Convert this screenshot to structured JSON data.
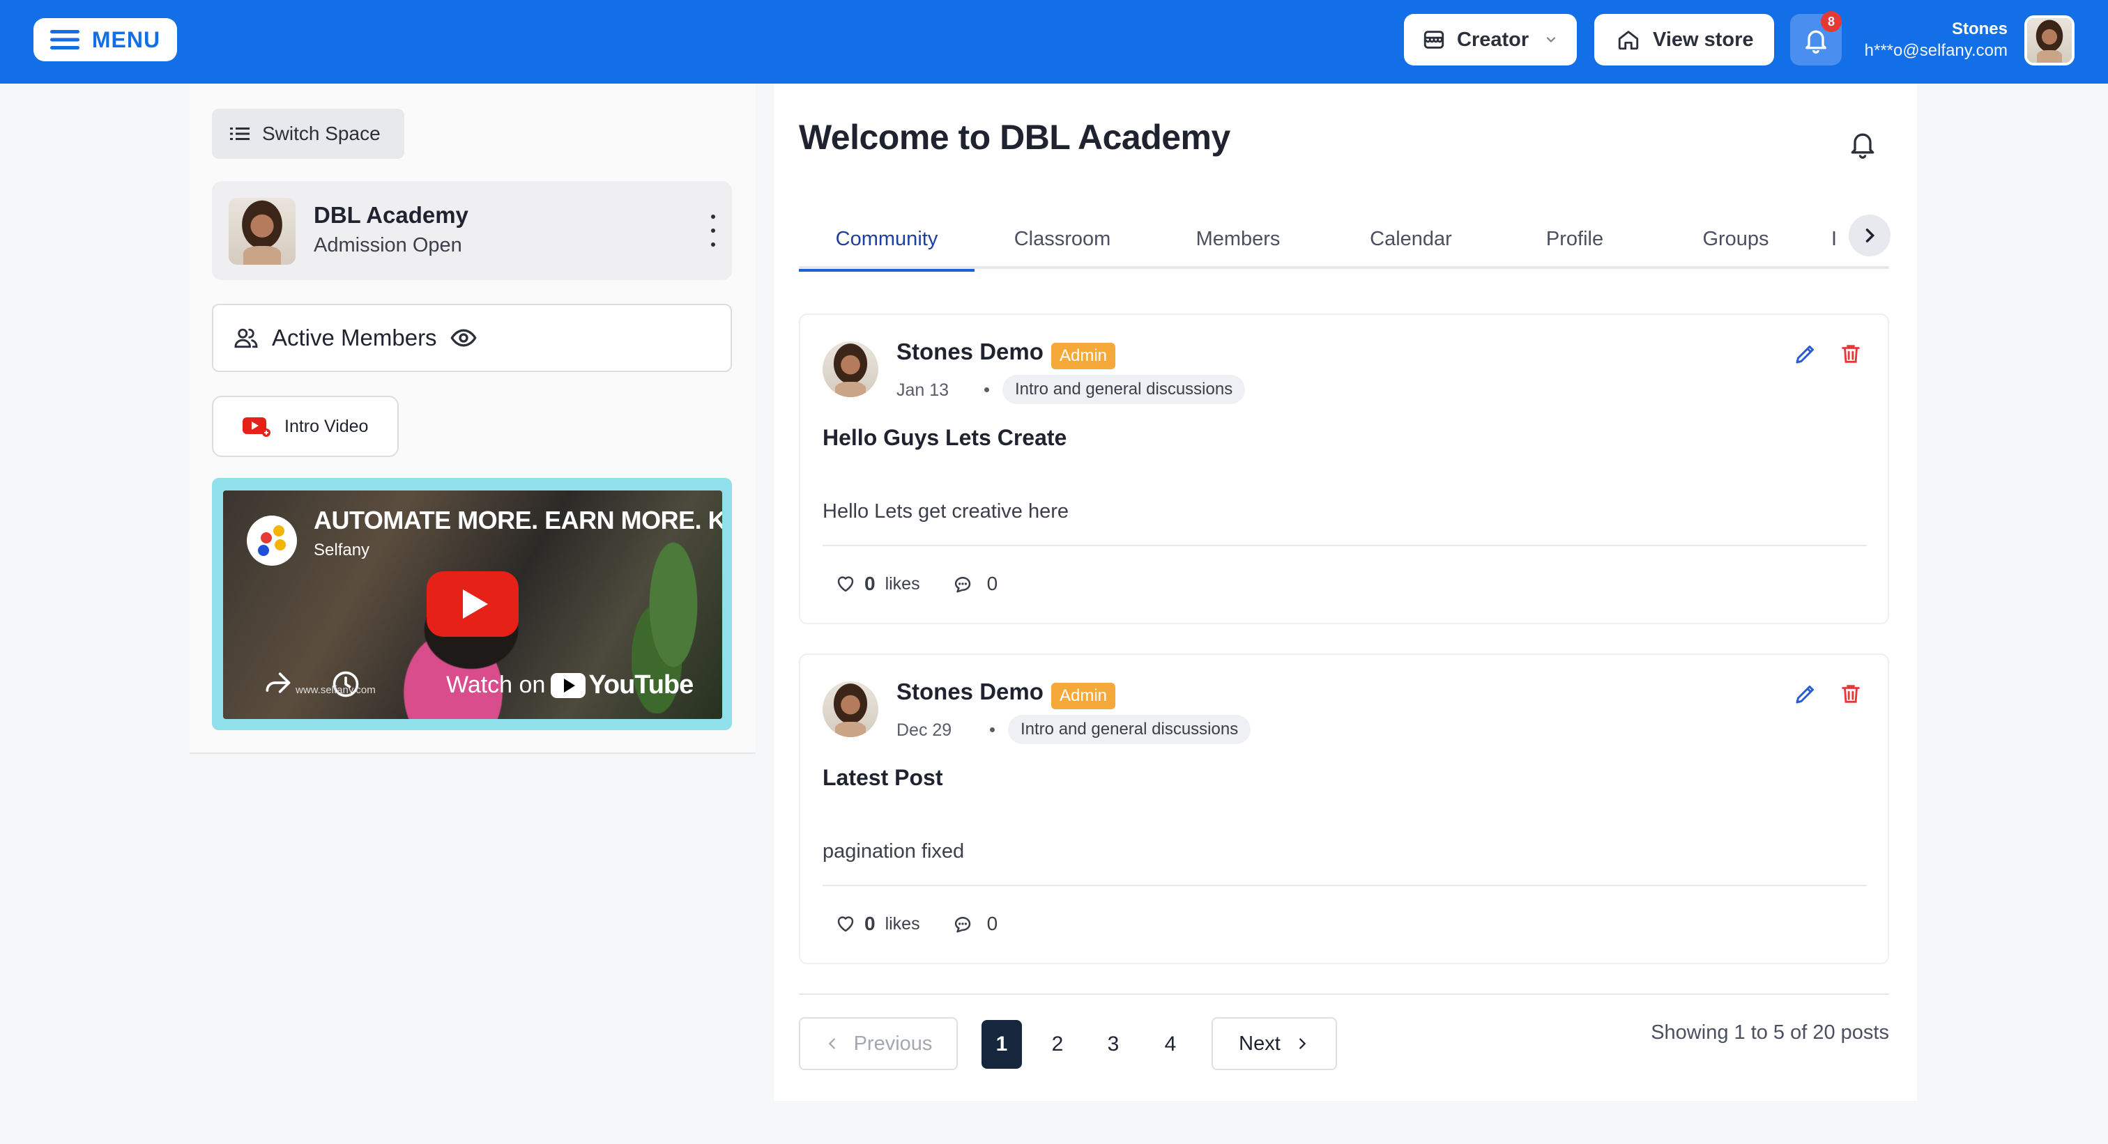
{
  "topbar": {
    "menu_label": "MENU",
    "creator_label": "Creator",
    "view_store_label": "View store",
    "notification_count": "8",
    "user_name": "Stones",
    "user_email": "h***o@selfany.com"
  },
  "sidebar": {
    "switch_space_label": "Switch Space",
    "academy_title": "DBL Academy",
    "academy_subtitle": "Admission Open",
    "active_members_label": "Active Members",
    "intro_video_label": "Intro Video",
    "video": {
      "title": "AUTOMATE MORE. EARN MORE. K",
      "channel": "Selfany",
      "watch_on": "Watch on",
      "youtube": "YouTube",
      "url_text": "www.selfany.com"
    }
  },
  "main": {
    "title": "Welcome to DBL Academy",
    "tabs": [
      {
        "label": "Community",
        "active": true
      },
      {
        "label": "Classroom",
        "active": false
      },
      {
        "label": "Members",
        "active": false
      },
      {
        "label": "Calendar",
        "active": false
      },
      {
        "label": "Profile",
        "active": false
      },
      {
        "label": "Groups",
        "active": false
      },
      {
        "label": "I",
        "active": false
      }
    ],
    "posts": [
      {
        "author": "Stones Demo",
        "badge": "Admin",
        "date": "Jan 13",
        "category": "Intro and general discussions",
        "heading": "Hello Guys Lets Create",
        "body": "Hello Lets get creative here",
        "likes": "0",
        "likes_label": "likes",
        "comments": "0"
      },
      {
        "author": "Stones Demo",
        "badge": "Admin",
        "date": "Dec 29",
        "category": "Intro and general discussions",
        "heading": "Latest Post",
        "body": "pagination fixed",
        "likes": "0",
        "likes_label": "likes",
        "comments": "0"
      }
    ],
    "pagination": {
      "previous_label": "Previous",
      "next_label": "Next",
      "pages": [
        "1",
        "2",
        "3",
        "4"
      ],
      "current_page": "1",
      "summary": "Showing 1 to 5 of 20 posts"
    }
  },
  "colors": {
    "brand_blue": "#136fe8",
    "admin_badge": "#f5a93b",
    "delete_red": "#e53935",
    "edit_blue": "#2a5bd7"
  },
  "icons": [
    "menu-icon",
    "store-front-icon",
    "chevron-down-icon",
    "home-icon",
    "bell-icon",
    "list-icon",
    "users-icon",
    "eye-icon",
    "youtube-icon",
    "share-icon",
    "clock-icon",
    "chevron-right-icon",
    "chevron-left-icon",
    "pencil-icon",
    "trash-icon",
    "heart-icon",
    "comment-icon"
  ]
}
